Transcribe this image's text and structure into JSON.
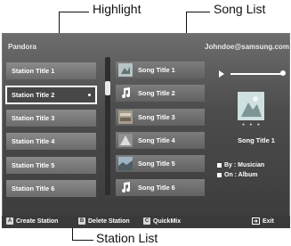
{
  "callouts": {
    "highlight": "Highlight",
    "song_list": "Song List",
    "station_list": "Station List"
  },
  "header": {
    "app": "Pandora",
    "account": "Johndoe@samsung.com"
  },
  "stations": [
    {
      "label": "Station Title 1"
    },
    {
      "label": "Station Title 2"
    },
    {
      "label": "Station Title 3"
    },
    {
      "label": "Station Title 4"
    },
    {
      "label": "Station Title 5"
    },
    {
      "label": "Station Title 6"
    }
  ],
  "selected_station_index": 1,
  "songs": [
    {
      "label": "Song Title 1",
      "icon": "album-art"
    },
    {
      "label": "Song Title 2",
      "icon": "music-note"
    },
    {
      "label": "Song Title 3",
      "icon": "album-art"
    },
    {
      "label": "Song Title 4",
      "icon": "album-art"
    },
    {
      "label": "Song Title 5",
      "icon": "album-art"
    },
    {
      "label": "Song Title 6",
      "icon": "music-note"
    }
  ],
  "now_playing": {
    "title": "Song Title 1",
    "by": "By : Musician",
    "on": "On : Album"
  },
  "footer": {
    "a_key": "A",
    "a_label": "Create Station",
    "b_key": "B",
    "b_label": "Delete Station",
    "c_key": "C",
    "c_label": "QuickMix",
    "exit_label": "Exit"
  },
  "colors": {
    "panel_bg": "#4c4c4c",
    "button_bg": "#7d7d7d",
    "selection": "#ffffff"
  }
}
